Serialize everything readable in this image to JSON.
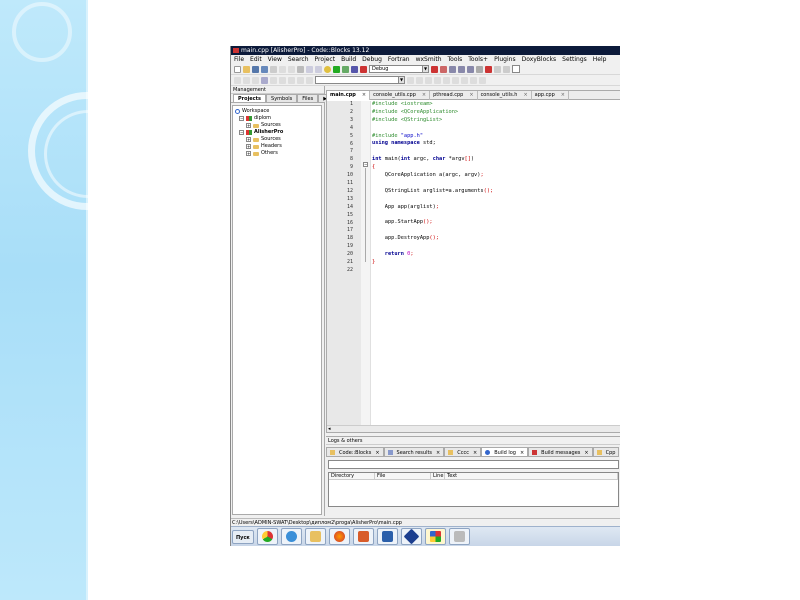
{
  "window": {
    "title": "main.cpp [AlisherPro] - Code::Blocks 13.12"
  },
  "menu": [
    "File",
    "Edit",
    "View",
    "Search",
    "Project",
    "Build",
    "Debug",
    "Fortran",
    "wxSmith",
    "Tools",
    "Tools+",
    "Plugins",
    "DoxyBlocks",
    "Settings",
    "Help"
  ],
  "toolbar": {
    "build_target": "Debug"
  },
  "management": {
    "title": "Management",
    "tabs": [
      "Projects",
      "Symbols",
      "Files"
    ],
    "active_tab": "Projects",
    "tree": [
      {
        "label": "Workspace",
        "level": 0,
        "type": "workspace"
      },
      {
        "label": "diplom",
        "level": 1,
        "type": "project",
        "expander": "-"
      },
      {
        "label": "Sources",
        "level": 2,
        "type": "folder",
        "expander": "+"
      },
      {
        "label": "AlisherPro",
        "level": 1,
        "type": "project",
        "expander": "-",
        "bold": true
      },
      {
        "label": "Sources",
        "level": 2,
        "type": "folder",
        "expander": "+"
      },
      {
        "label": "Headers",
        "level": 2,
        "type": "folder",
        "expander": "+"
      },
      {
        "label": "Others",
        "level": 2,
        "type": "folder",
        "expander": "+"
      }
    ]
  },
  "editor": {
    "tabs": [
      "main.cpp",
      "console_utils.cpp",
      "pthread.cpp",
      "console_utils.h",
      "app.cpp"
    ],
    "active_tab": "main.cpp",
    "line_numbers": [
      "1",
      "2",
      "3",
      "4",
      "5",
      "6",
      "7",
      "8",
      "9",
      "10",
      "11",
      "12",
      "13",
      "14",
      "15",
      "16",
      "17",
      "18",
      "19",
      "20",
      "21",
      "22"
    ]
  },
  "logs": {
    "title": "Logs & others",
    "tabs": [
      "Code::Blocks",
      "Search results",
      "Cccc",
      "Build log",
      "Build messages",
      "Cpp"
    ],
    "columns": [
      "Directory",
      "File",
      "Line",
      "Text"
    ]
  },
  "statusbar": {
    "path": "C:\\Users\\ADMIN-SWAT\\Desktop\\диплом2\\proga\\AlisherPro\\main.cpp"
  },
  "taskbar": {
    "start_label": "Пуск",
    "apps": [
      "chrome-icon",
      "ie-icon",
      "explorer-icon",
      "firefox-icon",
      "media-icon",
      "word-icon",
      "network-icon",
      "codeblocks-icon",
      "tools-icon"
    ]
  }
}
